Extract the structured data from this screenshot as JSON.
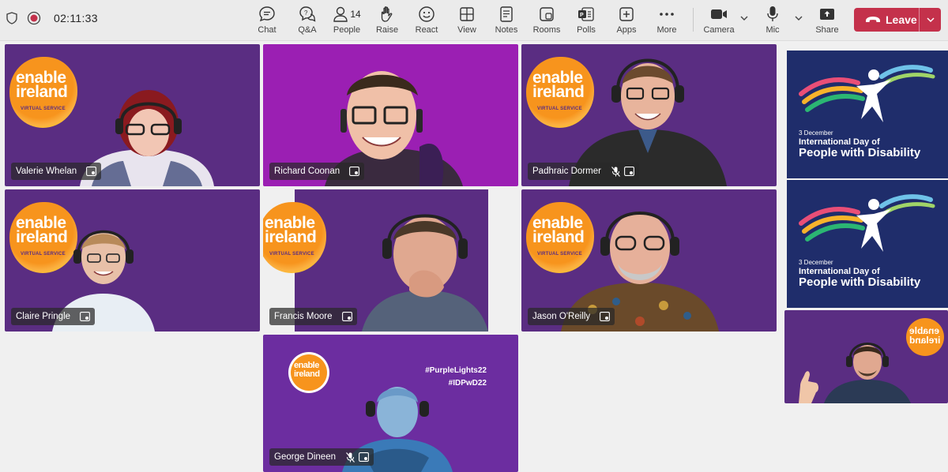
{
  "meeting": {
    "timer": "02:11:33",
    "colors": {
      "bar": "#ebebeb",
      "leave": "#c4314b",
      "tile_purple": "#5a2d82"
    }
  },
  "toolbar": {
    "chat": {
      "label": "Chat",
      "icon": "chat-icon"
    },
    "qa": {
      "label": "Q&A",
      "icon": "qa-icon"
    },
    "people": {
      "label": "People",
      "count": "14",
      "icon": "people-icon"
    },
    "raise": {
      "label": "Raise",
      "icon": "hand-icon"
    },
    "react": {
      "label": "React",
      "icon": "smile-icon"
    },
    "view": {
      "label": "View",
      "icon": "grid-icon"
    },
    "notes": {
      "label": "Notes",
      "icon": "notes-icon"
    },
    "rooms": {
      "label": "Rooms",
      "icon": "rooms-icon"
    },
    "polls": {
      "label": "Polls",
      "icon": "polls-icon"
    },
    "apps": {
      "label": "Apps",
      "icon": "plus-icon"
    },
    "more": {
      "label": "More",
      "icon": "ellipsis-icon"
    },
    "camera": {
      "label": "Camera",
      "icon": "camera-icon"
    },
    "mic": {
      "label": "Mic",
      "icon": "mic-icon"
    },
    "share": {
      "label": "Share",
      "icon": "share-icon"
    },
    "leave": {
      "label": "Leave",
      "icon": "phone-hangup-icon"
    }
  },
  "branding": {
    "logo_line1": "enable",
    "logo_line2": "ireland",
    "logo_tag": "VIRTUAL SERVICE",
    "hashtag1": "#PurpleLights22",
    "hashtag2": "#IDPwD22",
    "idpwd_date": "3 December",
    "idpwd_line1": "International Day of",
    "idpwd_line2": "People with Disability"
  },
  "participants": [
    {
      "name": "Valerie Whelan",
      "muted": false
    },
    {
      "name": "Richard Coonan",
      "muted": false
    },
    {
      "name": "Padhraic Dormer",
      "muted": true
    },
    {
      "name": "Claire Pringle",
      "muted": false
    },
    {
      "name": "Francis Moore",
      "muted": false
    },
    {
      "name": "Jason O'Reilly",
      "muted": false
    },
    {
      "name": "George Dineen",
      "muted": true
    }
  ]
}
